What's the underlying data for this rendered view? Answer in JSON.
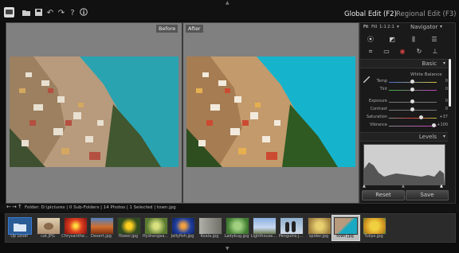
{
  "toolbar": {
    "icons": [
      "app-logo-icon",
      "folder-icon",
      "save-icon",
      "undo-icon",
      "redo-icon",
      "help-icon",
      "info-icon"
    ]
  },
  "modes": {
    "global": "Global Edit (F2)",
    "regional": "Regional Edit (F3)"
  },
  "compare": {
    "before": "Before",
    "after": "After"
  },
  "navigator": {
    "zoom_options": [
      "Fit",
      "Fill",
      "1:1",
      "2:1"
    ],
    "zoom_extra": "▾",
    "title": "Navigator"
  },
  "basic": {
    "title": "Basic",
    "white_balance": "White Balance",
    "sliders": [
      {
        "label": "Temp",
        "value": "0"
      },
      {
        "label": "Tint",
        "value": "0"
      },
      {
        "label": "Exposure",
        "value": "0"
      },
      {
        "label": "Contrast",
        "value": "0"
      },
      {
        "label": "Saturation",
        "value": "+37"
      },
      {
        "label": "Vibrance",
        "value": "+100"
      }
    ]
  },
  "levels": {
    "title": "Levels"
  },
  "actions": {
    "reset": "Reset",
    "save": "Save"
  },
  "folder_bar": {
    "text": "Folder: D:\\pictures | 0 Sub-Folders | 14 Photos | 1 Selected | town.jpg"
  },
  "filmstrip": [
    {
      "label": "Up Level",
      "icon": "folder-icon"
    },
    {
      "label": "cat.JPG"
    },
    {
      "label": "Chrysanthe..."
    },
    {
      "label": "Desert.jpg"
    },
    {
      "label": "flower.jpg"
    },
    {
      "label": "Hydrangea..."
    },
    {
      "label": "Jellyfish.jpg"
    },
    {
      "label": "Koala.jpg"
    },
    {
      "label": "Ladybug.jpg"
    },
    {
      "label": "Lighthouse..."
    },
    {
      "label": "Penguins.j..."
    },
    {
      "label": "spider.jpg"
    },
    {
      "label": "town.jpg",
      "selected": true
    },
    {
      "label": "Tulips.jpg"
    }
  ],
  "colors": {
    "accent": "#3a7bd5",
    "sea": "#1aa9c2",
    "selected_bg": "#bdbdbd"
  }
}
